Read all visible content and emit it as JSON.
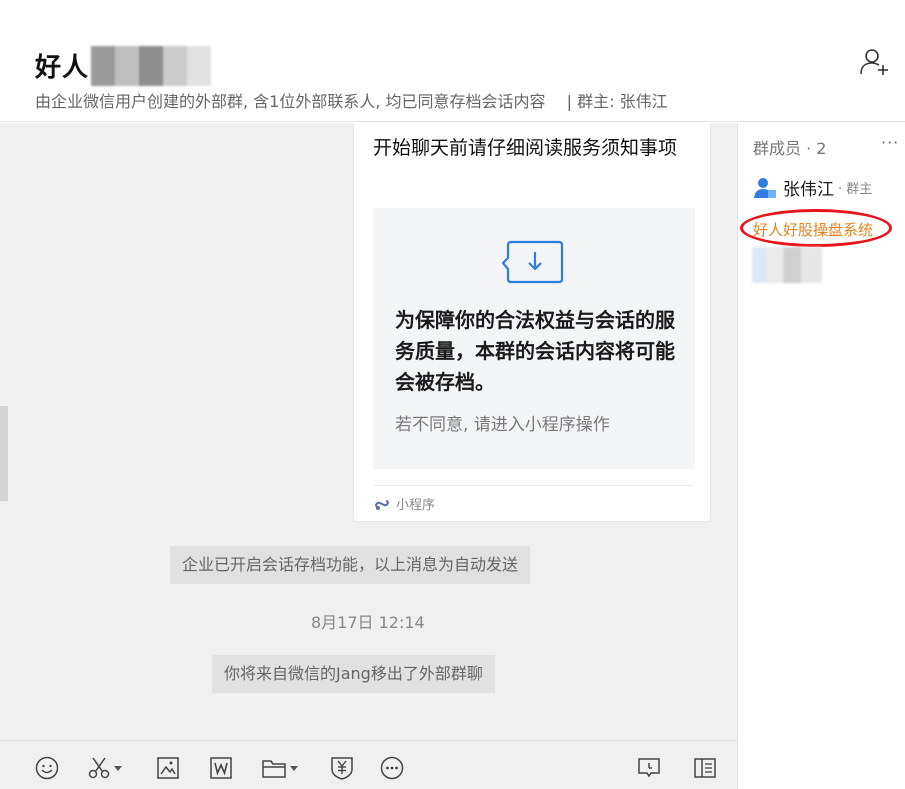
{
  "window": {
    "minimize_icon": "minimize-icon",
    "maximize_icon": "maximize-icon",
    "close_icon": "close-icon"
  },
  "header": {
    "title": "好人",
    "subtitle": "由企业微信用户创建的外部群, 含1位外部联系人, 均已同意存档会话内容",
    "owner": "| 群主: 张伟江"
  },
  "card": {
    "title": "开始聊天前请仔细阅读服务须知事项",
    "main_text": "为保障你的合法权益与会话的服务质量，本群的会话内容将可能会被存档。",
    "sub_text": "若不同意, 请进入小程序操作",
    "footer_label": "小程序"
  },
  "messages": {
    "system_1": "企业已开启会话存档功能，以上消息为自动发送",
    "timestamp": "8月17日 12:14",
    "system_2": "你将来自微信的Jang移出了外部群聊"
  },
  "members": {
    "title": "群成员 · 2",
    "more": "···",
    "list": [
      {
        "name": "张伟江",
        "role": "· 群主"
      },
      {
        "name": "好人好股操盘系统"
      }
    ]
  },
  "colors": {
    "accent_orange": "#e8821e",
    "annotation_red": "#e8131b",
    "icon_blue": "#2f7de1"
  }
}
